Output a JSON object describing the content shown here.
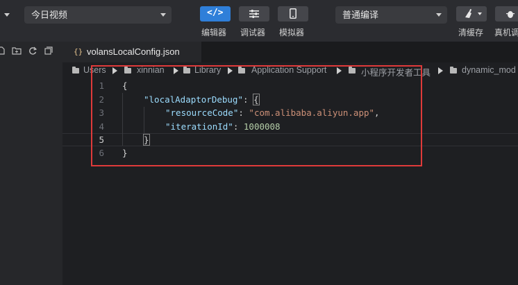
{
  "toolbar": {
    "page_select": "今日视频",
    "editor_label": "编辑器",
    "debugger_label": "调试器",
    "simulator_label": "模拟器",
    "compile_select": "普通编译",
    "clear_cache_label": "清缓存",
    "real_device_label": "真机调"
  },
  "tab": {
    "icon": "{}",
    "filename": "volansLocalConfig.json"
  },
  "breadcrumb": [
    "Users",
    "xinnian",
    "Library",
    "Application Support",
    "小程序开发者工具",
    "dynamic_mod"
  ],
  "editor": {
    "line_numbers": [
      "1",
      "2",
      "3",
      "4",
      "5",
      "6"
    ],
    "current_line": 5,
    "code": {
      "open_brace": "{",
      "key1": "\"localAdaptorDebug\"",
      "sep1": ": ",
      "open_brace2": "{",
      "key2": "\"resourceCode\"",
      "sep2": ": ",
      "val2": "\"com.alibaba.aliyun.app\"",
      "comma2": ",",
      "key3": "\"iterationId\"",
      "sep3": ": ",
      "val3": "1000008",
      "close_brace2": "}",
      "close_brace": "}"
    }
  },
  "colors": {
    "accent": "#2f7fd9",
    "highlight": "#e03a3a"
  }
}
